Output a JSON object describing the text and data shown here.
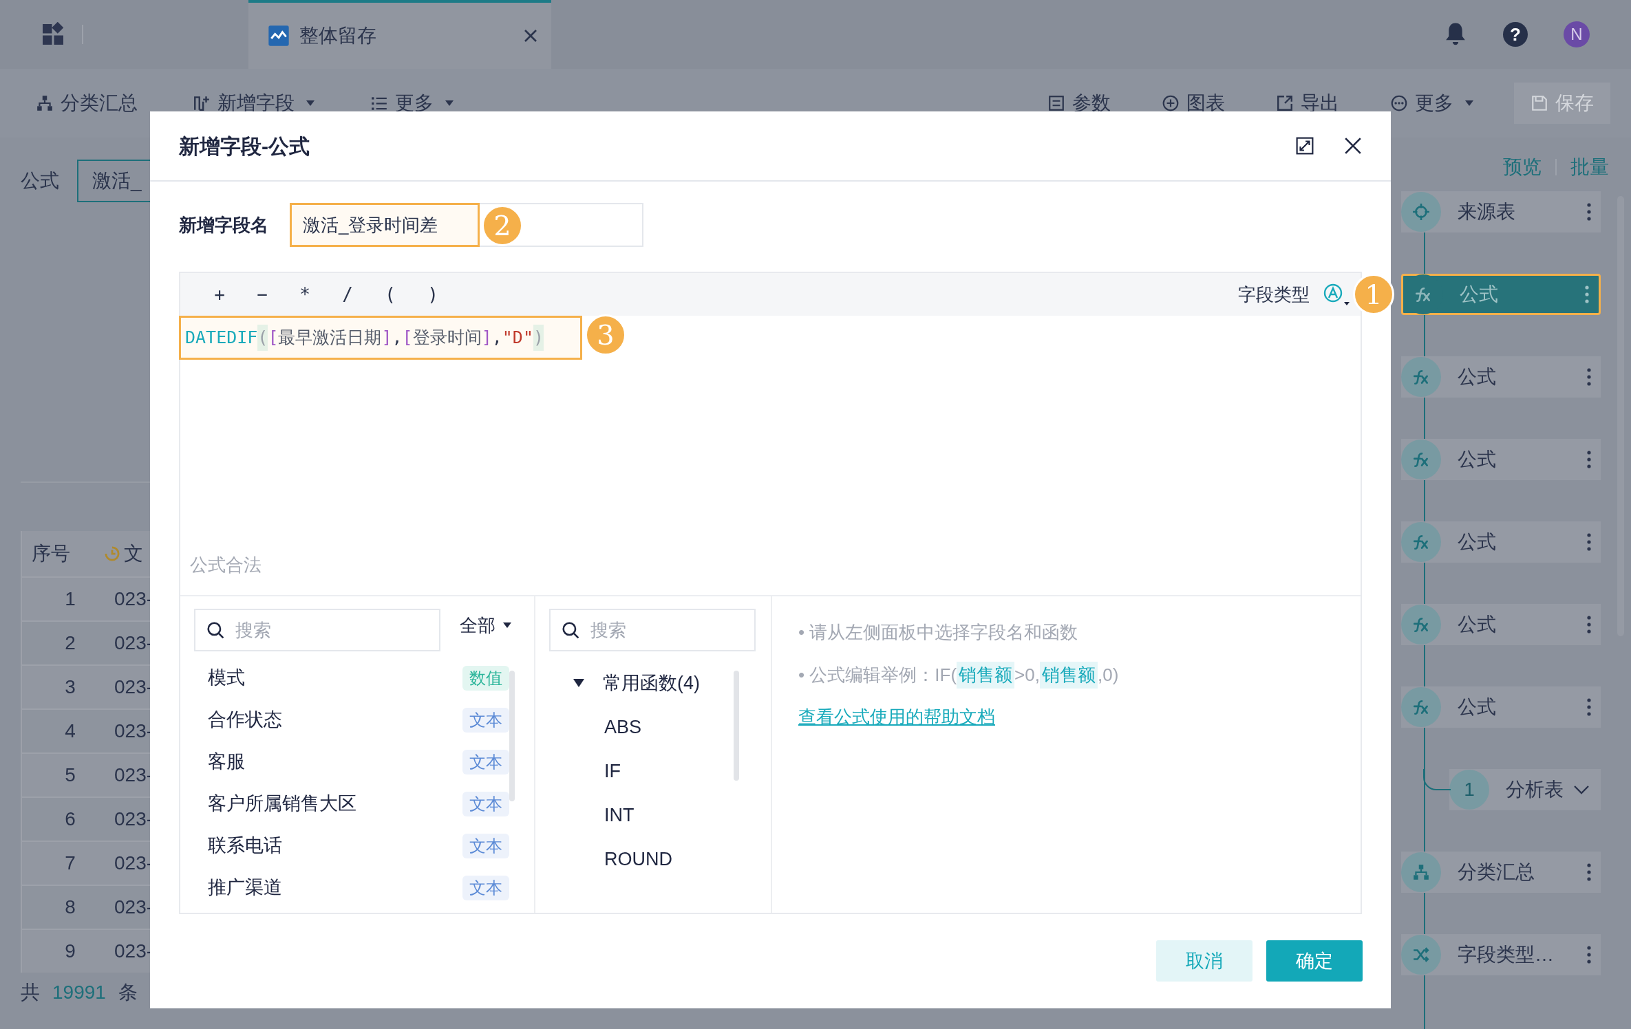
{
  "top_bar": {
    "tab": {
      "title": "整体留存"
    },
    "help": "?",
    "avatar": "N"
  },
  "toolbar": {
    "left": [
      {
        "label": "分类汇总",
        "kind": "hierarchy",
        "dropdown": false
      },
      {
        "label": "新增字段",
        "kind": "add-column",
        "dropdown": true
      },
      {
        "label": "更多",
        "kind": "list",
        "dropdown": true
      }
    ],
    "right": [
      {
        "label": "参数",
        "kind": "param",
        "dropdown": false,
        "disabled": false
      },
      {
        "label": "图表",
        "kind": "plus-circle",
        "dropdown": false,
        "disabled": false
      },
      {
        "label": "导出",
        "kind": "export",
        "dropdown": false,
        "disabled": false
      },
      {
        "label": "更多",
        "kind": "dots-circle",
        "dropdown": true,
        "disabled": false
      },
      {
        "label": "保存",
        "kind": "save",
        "dropdown": false,
        "disabled": true
      }
    ]
  },
  "formula_bar": {
    "label": "公式",
    "value": "激活_"
  },
  "table": {
    "columns": [
      "序号",
      "文"
    ],
    "rows": [
      [
        "1",
        "023-"
      ],
      [
        "2",
        "023-"
      ],
      [
        "3",
        "023-"
      ],
      [
        "4",
        "023-"
      ],
      [
        "5",
        "023-"
      ],
      [
        "6",
        "023-"
      ],
      [
        "7",
        "023-"
      ],
      [
        "8",
        "023-"
      ],
      [
        "9",
        "023-"
      ]
    ]
  },
  "footer": {
    "prefix": "共",
    "count": "19991",
    "suffix": "条"
  },
  "dialog": {
    "title": "新增字段-公式",
    "field_name": {
      "label": "新增字段名",
      "value": "激活_登录时间差"
    },
    "operators": [
      "+",
      "−",
      "*",
      "/",
      "(",
      ")"
    ],
    "field_type": {
      "label": "字段类型"
    },
    "formula": [
      {
        "text": "DATEDIF",
        "kind": "function"
      },
      {
        "text": "(",
        "kind": "paren"
      },
      {
        "text": "[最早激活日期]",
        "kind": "field"
      },
      {
        "text": ",",
        "kind": "comma"
      },
      {
        "text": "[登录时间]",
        "kind": "field"
      },
      {
        "text": ",",
        "kind": "comma"
      },
      {
        "text": "\"D\"",
        "kind": "string"
      },
      {
        "text": ")",
        "kind": "paren"
      }
    ],
    "status": "公式合法",
    "fields_panel": {
      "placeholder": "搜索",
      "filter": "全部",
      "items": [
        {
          "name": "模式",
          "type": "数值",
          "kind": "number"
        },
        {
          "name": "合作状态",
          "type": "文本",
          "kind": "text"
        },
        {
          "name": "客服",
          "type": "文本",
          "kind": "text"
        },
        {
          "name": "客户所属销售大区",
          "type": "文本",
          "kind": "text"
        },
        {
          "name": "联系电话",
          "type": "文本",
          "kind": "text"
        },
        {
          "name": "推广渠道",
          "type": "文本",
          "kind": "text"
        }
      ]
    },
    "functions_panel": {
      "placeholder": "搜索",
      "groups": [
        {
          "label": "常用函数(4)",
          "expanded": true,
          "children": [
            "ABS",
            "IF",
            "INT",
            "ROUND"
          ]
        }
      ]
    },
    "help": {
      "tips": [
        [
          {
            "text": "• 请从左侧面板中选择字段名和函数",
            "kind": "plain"
          }
        ],
        [
          {
            "text": "• 公式编辑举例：IF(",
            "kind": "plain"
          },
          {
            "text": "销售额",
            "kind": "field"
          },
          {
            "text": ">0,",
            "kind": "plain"
          },
          {
            "text": "销售额",
            "kind": "field"
          },
          {
            "text": ",0)",
            "kind": "plain"
          }
        ]
      ],
      "link": "查看公式使用的帮助文档"
    },
    "buttons": [
      {
        "label": "取消",
        "kind": "secondary"
      },
      {
        "label": "确定",
        "kind": "primary"
      }
    ]
  },
  "steps_panel": {
    "links": [
      "预览",
      "批量"
    ],
    "steps": [
      {
        "label": "来源表",
        "kind": "target",
        "selected": false
      },
      {
        "label": "公式",
        "kind": "fx",
        "selected": true
      },
      {
        "label": "公式",
        "kind": "fx",
        "selected": false
      },
      {
        "label": "公式",
        "kind": "fx",
        "selected": false
      },
      {
        "label": "公式",
        "kind": "fx",
        "selected": false
      },
      {
        "label": "公式",
        "kind": "fx",
        "selected": false
      },
      {
        "label": "公式",
        "kind": "fx",
        "selected": false
      },
      {
        "label": "分析表",
        "kind": "branch",
        "count": "1",
        "selected": false
      },
      {
        "label": "分类汇总",
        "kind": "hierarchy",
        "selected": false
      },
      {
        "label": "字段类型…",
        "kind": "shuffle",
        "selected": false
      }
    ]
  },
  "annotations": [
    "1",
    "2",
    "3"
  ]
}
